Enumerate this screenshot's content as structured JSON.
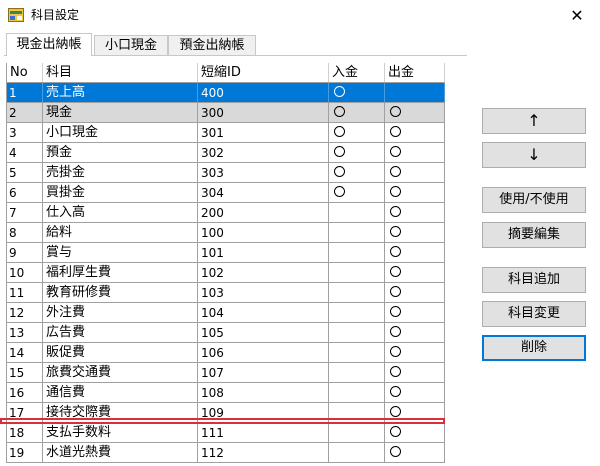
{
  "window": {
    "title": "科目設定",
    "close_glyph": "✕"
  },
  "tabs": [
    {
      "label": "現金出納帳"
    },
    {
      "label": "小口現金"
    },
    {
      "label": "預金出納帳"
    }
  ],
  "table": {
    "headers": [
      "No",
      "科目",
      "短縮ID",
      "入金",
      "出金"
    ],
    "rows": [
      {
        "no": "1",
        "name": "売上高",
        "code": "400",
        "in": true,
        "out": false
      },
      {
        "no": "2",
        "name": "現金",
        "code": "300",
        "in": true,
        "out": true
      },
      {
        "no": "3",
        "name": "小口現金",
        "code": "301",
        "in": true,
        "out": true
      },
      {
        "no": "4",
        "name": "預金",
        "code": "302",
        "in": true,
        "out": true
      },
      {
        "no": "5",
        "name": "売掛金",
        "code": "303",
        "in": true,
        "out": true
      },
      {
        "no": "6",
        "name": "買掛金",
        "code": "304",
        "in": true,
        "out": true
      },
      {
        "no": "7",
        "name": "仕入高",
        "code": "200",
        "in": false,
        "out": true
      },
      {
        "no": "8",
        "name": "給料",
        "code": "100",
        "in": false,
        "out": true
      },
      {
        "no": "9",
        "name": "賞与",
        "code": "101",
        "in": false,
        "out": true
      },
      {
        "no": "10",
        "name": "福利厚生費",
        "code": "102",
        "in": false,
        "out": true
      },
      {
        "no": "11",
        "name": "教育研修費",
        "code": "103",
        "in": false,
        "out": true
      },
      {
        "no": "12",
        "name": "外注費",
        "code": "104",
        "in": false,
        "out": true
      },
      {
        "no": "13",
        "name": "広告費",
        "code": "105",
        "in": false,
        "out": true
      },
      {
        "no": "14",
        "name": "販促費",
        "code": "106",
        "in": false,
        "out": true
      },
      {
        "no": "15",
        "name": "旅費交通費",
        "code": "107",
        "in": false,
        "out": true
      },
      {
        "no": "16",
        "name": "通信費",
        "code": "108",
        "in": false,
        "out": true
      },
      {
        "no": "17",
        "name": "接待交際費",
        "code": "109",
        "in": false,
        "out": true
      },
      {
        "no": "18",
        "name": "支払手数料",
        "code": "111",
        "in": false,
        "out": true
      },
      {
        "no": "19",
        "name": "水道光熱費",
        "code": "112",
        "in": false,
        "out": true
      }
    ],
    "selected_row": 1,
    "highlighted_row": 2
  },
  "buttons": {
    "up": "↑",
    "down": "↓",
    "toggle_use": "使用/不使用",
    "edit_summary": "摘要編集",
    "add_account": "科目追加",
    "change_account": "科目変更",
    "delete": "削除"
  },
  "colors": {
    "selection": "#0078d7",
    "highlight_row": "#d9d9d9",
    "annotation_red": "#d8303a"
  }
}
